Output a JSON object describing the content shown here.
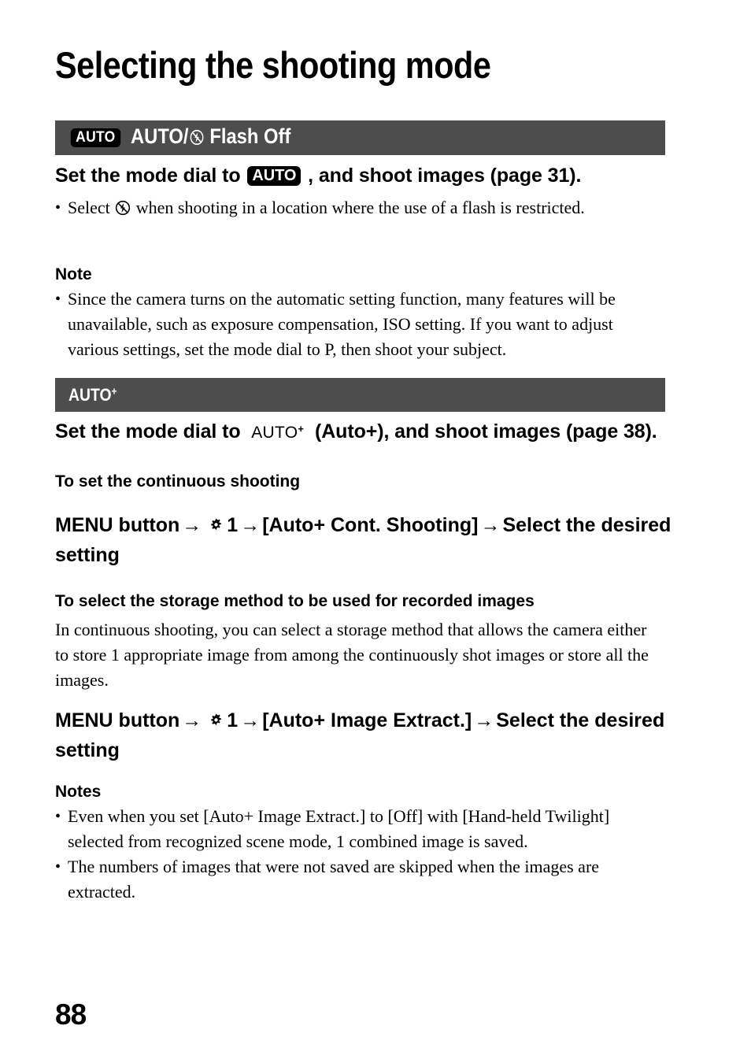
{
  "page": {
    "title": "Selecting the shooting mode",
    "number": "88",
    "bar_color": "#4d4d4d",
    "badge_color": "#000000",
    "text_color": "#000000"
  },
  "section_auto": {
    "bar": {
      "badge_label": "AUTO",
      "title_prefix": "AUTO/",
      "flash_icon": "flash-off-icon",
      "title_suffix": "Flash Off"
    },
    "instruction": {
      "prefix": "Set the mode dial to",
      "badge_label": "AUTO",
      "suffix": ", and shoot images (page 31)."
    },
    "bullets": [
      {
        "prefix": "Select",
        "icon": "flash-off-icon",
        "suffix": "when shooting in a location where the use of a flash is restricted."
      }
    ],
    "note_heading": "Note",
    "notes": [
      "Since the camera turns on the automatic setting function, many features will be unavailable, such as exposure compensation, ISO setting. If you want to adjust various settings, set the mode dial to P, then shoot your subject."
    ]
  },
  "section_auto_plus": {
    "bar": {
      "title": "AUTO",
      "superscript": "+"
    },
    "instruction": {
      "prefix": "Set the mode dial to",
      "dial_label": "AUTO",
      "dial_superscript": "+",
      "suffix": "(Auto+), and shoot images (page 38)."
    },
    "subsection_continuous": {
      "heading": "To set the continuous shooting",
      "menu_path": {
        "start": "MENU button",
        "arrow": "→",
        "gear_icon": "gear-icon",
        "tab_number": "1",
        "item": "[Auto+ Cont. Shooting]",
        "end": "Select the desired setting"
      }
    },
    "subsection_storage": {
      "heading": "To select the storage method to be used for recorded images",
      "body": "In continuous shooting, you can select a storage method that allows the camera either to store 1 appropriate image from among the continuously shot images or store all the images.",
      "menu_path": {
        "start": "MENU button",
        "arrow": "→",
        "gear_icon": "gear-icon",
        "tab_number": "1",
        "item": "[Auto+ Image Extract.]",
        "end": "Select the desired setting"
      }
    },
    "notes_heading": "Notes",
    "notes": [
      "Even when you set [Auto+ Image Extract.] to [Off] with [Hand-held Twilight] selected from recognized scene mode, 1 combined image is saved.",
      "The numbers of images that were not saved are skipped when the images are extracted."
    ]
  },
  "symbols": {
    "bullet": "•",
    "arrow": "→"
  }
}
